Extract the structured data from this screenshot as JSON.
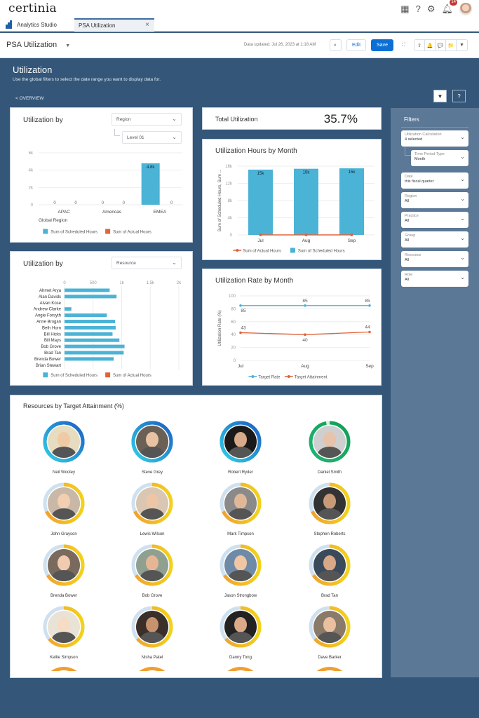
{
  "app": {
    "logo": "certinia",
    "notification_count": "14",
    "top_icons": [
      "app-launcher-icon",
      "help-icon",
      "settings-icon",
      "notifications-icon",
      "user-avatar"
    ]
  },
  "tabs": {
    "app_name": "Analytics Studio",
    "active_tab": "PSA Utilization",
    "close_glyph": "×"
  },
  "toolbar": {
    "title": "PSA Utilization",
    "title_caret": "▼",
    "updated": "Data updated: Jul 26, 2023 at 1:18 AM",
    "edit_label": "Edit",
    "save_label": "Save",
    "theme_glyph": "◐",
    "fullscreen_glyph": "⛶",
    "group_glyphs": [
      "⇪",
      "🔔",
      "💬",
      "📁",
      "▼"
    ]
  },
  "page": {
    "title": "Utilization",
    "subtitle": "Use the global filters to select the date range you want to display data for.",
    "back_link": "< OVERVIEW",
    "filter_glyph": "▼",
    "help_glyph": "?"
  },
  "region_card": {
    "title": "Utilization by",
    "select_value": "Region",
    "sub_select_value": "Level 01"
  },
  "resource_card": {
    "title": "Utilization by",
    "select_value": "Resource"
  },
  "total": {
    "label": "Total Utilization",
    "value": "35.7%"
  },
  "hours_card": {
    "title": "Utilization Hours by Month"
  },
  "rate_card": {
    "title": "Utilization Rate by Month"
  },
  "chart_data": [
    {
      "type": "bar",
      "title": "Utilization by Region",
      "categories": [
        "APAC",
        "Americas",
        "EMEA"
      ],
      "xlabel": "Global Region",
      "ylabel": "",
      "ylim": [
        0,
        6000
      ],
      "yticks": [
        "0",
        "2k",
        "4k",
        "6k"
      ],
      "grid": true,
      "legend": "bottom",
      "series": [
        {
          "name": "Sum of Scheduled Hours",
          "color": "#4bb3d6",
          "values": [
            0,
            0,
            4800
          ],
          "labels": [
            "0",
            "0",
            "4.8k"
          ]
        },
        {
          "name": "Sum of Actual Hours",
          "color": "#e0643a",
          "values": [
            0,
            0,
            0
          ],
          "labels": [
            "0",
            "0",
            "0"
          ]
        }
      ]
    },
    {
      "type": "bar",
      "orientation": "horizontal",
      "title": "Utilization by Resource",
      "categories": [
        "Ahmet Arya",
        "Alan Davids",
        "Alvan Kose",
        "Andrew Clarke",
        "Angie Forsyth",
        "Anne Brogan",
        "Beth Horn",
        "Bill Hicks",
        "Bill Mays",
        "Bob Grove",
        "Brad Tan",
        "Brenda Bower",
        "Brian Stewart"
      ],
      "xlim": [
        0,
        2000
      ],
      "xticks": [
        "0",
        "500",
        "1k",
        "1.5k",
        "2k"
      ],
      "grid": true,
      "legend": "bottom",
      "series": [
        {
          "name": "Sum of Scheduled Hours",
          "color": "#4bb3d6",
          "values": [
            790,
            910,
            0,
            120,
            740,
            885,
            895,
            840,
            960,
            1050,
            1035,
            860,
            0
          ]
        },
        {
          "name": "Sum of Actual Hours",
          "color": "#e0643a",
          "values": [
            0,
            0,
            0,
            0,
            0,
            0,
            0,
            0,
            0,
            0,
            0,
            0,
            0
          ]
        }
      ]
    },
    {
      "type": "bar",
      "title": "Utilization Hours by Month",
      "categories": [
        "Jul",
        "Aug",
        "Sep"
      ],
      "ylabel": "Sum of Scheduled Hours, Sum ...",
      "ylim": [
        0,
        16000
      ],
      "yticks": [
        "0",
        "4k",
        "8k",
        "12k",
        "16k"
      ],
      "grid": true,
      "legend": "bottom",
      "series": [
        {
          "name": "Sum of Scheduled Hours",
          "color": "#4bb3d6",
          "values": [
            15200,
            15400,
            15500
          ],
          "labels": [
            "15k",
            "15k",
            "15k"
          ]
        },
        {
          "name": "Sum of Actual Hours",
          "type": "line",
          "color": "#e0643a",
          "values": [
            0,
            0,
            0
          ]
        }
      ],
      "legend_order": [
        "Sum of Actual Hours",
        "Sum of Scheduled Hours"
      ]
    },
    {
      "type": "line",
      "title": "Utilization Rate by Month",
      "categories": [
        "Jul",
        "Aug",
        "Sep"
      ],
      "ylabel": "Utilization Rate (%)",
      "ylim": [
        0,
        100
      ],
      "yticks": [
        "0",
        "20",
        "40",
        "60",
        "80",
        "100"
      ],
      "grid": true,
      "legend": "bottom",
      "series": [
        {
          "name": "Target Rate",
          "color": "#4bb3d6",
          "values": [
            85,
            85,
            85
          ]
        },
        {
          "name": "Target Attainment",
          "color": "#e0643a",
          "values": [
            43,
            40,
            44
          ]
        }
      ]
    }
  ],
  "filters": {
    "title": "Filters",
    "items": [
      {
        "label": "Utilization Calculation",
        "value": "4 selected"
      },
      {
        "label": "Time Period Type",
        "value": "Month",
        "nested": true
      },
      {
        "label": "Date",
        "value": "this fiscal quarter"
      },
      {
        "label": "Region",
        "value": "All"
      },
      {
        "label": "Practice",
        "value": "All"
      },
      {
        "label": "Group",
        "value": "All"
      },
      {
        "label": "Resource",
        "value": "All"
      },
      {
        "label": "Role",
        "value": "All"
      }
    ]
  },
  "resources": {
    "title": "Resources by Target Attainment (%)",
    "people": [
      {
        "name": "Neil Wooley",
        "attainment": 1.0,
        "ring": "blue"
      },
      {
        "name": "Steve Grey",
        "attainment": 1.0,
        "ring": "blue"
      },
      {
        "name": "Robert Ryder",
        "attainment": 1.0,
        "ring": "blue"
      },
      {
        "name": "Daniel Smith",
        "attainment": 0.97,
        "ring": "green"
      },
      {
        "name": "John Grayson",
        "attainment": 0.68,
        "ring": "yellow"
      },
      {
        "name": "Lewis Wilson",
        "attainment": 0.68,
        "ring": "yellow"
      },
      {
        "name": "Mark Timpson",
        "attainment": 0.68,
        "ring": "yellow"
      },
      {
        "name": "Stephen Roberts",
        "attainment": 0.68,
        "ring": "yellow"
      },
      {
        "name": "Brenda Bower",
        "attainment": 0.66,
        "ring": "yellow"
      },
      {
        "name": "Bob Grove",
        "attainment": 0.66,
        "ring": "yellow"
      },
      {
        "name": "Jason Strongbow",
        "attainment": 0.66,
        "ring": "yellow"
      },
      {
        "name": "Brad Tan",
        "attainment": 0.66,
        "ring": "yellow"
      },
      {
        "name": "Kellie Simpson",
        "attainment": 0.64,
        "ring": "yellow"
      },
      {
        "name": "Nisha Patel",
        "attainment": 0.64,
        "ring": "yellow"
      },
      {
        "name": "Danny Tong",
        "attainment": 0.64,
        "ring": "yellow"
      },
      {
        "name": "Dave Barker",
        "attainment": 0.64,
        "ring": "yellow"
      }
    ]
  }
}
